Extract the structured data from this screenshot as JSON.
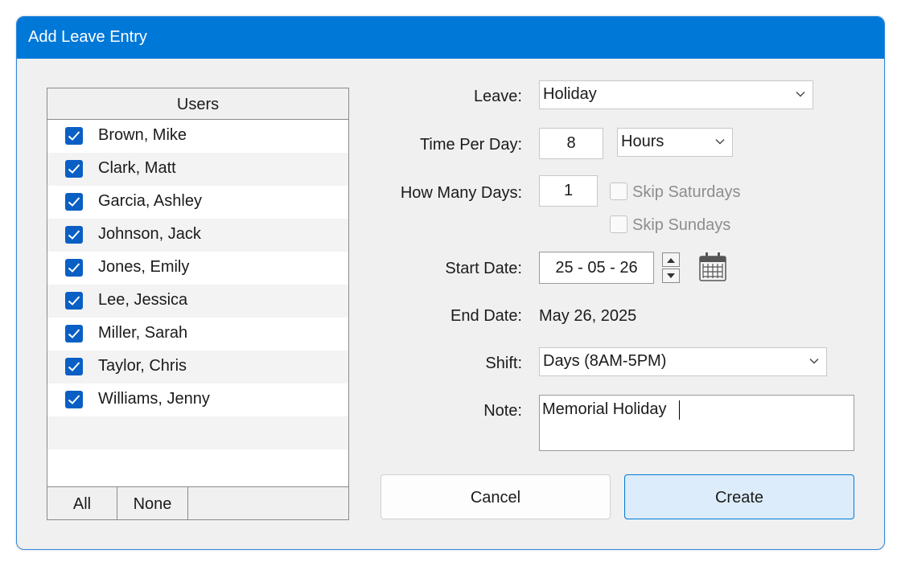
{
  "window": {
    "title": "Add Leave Entry"
  },
  "users": {
    "header": "Users",
    "items": [
      {
        "name": "Brown, Mike",
        "checked": true
      },
      {
        "name": "Clark, Matt",
        "checked": true
      },
      {
        "name": "Garcia, Ashley",
        "checked": true
      },
      {
        "name": "Johnson, Jack",
        "checked": true
      },
      {
        "name": "Jones, Emily",
        "checked": true
      },
      {
        "name": "Lee, Jessica",
        "checked": true
      },
      {
        "name": "Miller, Sarah",
        "checked": true
      },
      {
        "name": "Taylor, Chris",
        "checked": true
      },
      {
        "name": "Williams, Jenny",
        "checked": true
      }
    ],
    "all_label": "All",
    "none_label": "None"
  },
  "form": {
    "leave_label": "Leave:",
    "leave_value": "Holiday",
    "time_per_day_label": "Time Per Day:",
    "time_per_day_value": "8",
    "time_unit_value": "Hours",
    "how_many_days_label": "How Many Days:",
    "how_many_days_value": "1",
    "skip_saturdays_label": "Skip Saturdays",
    "skip_saturdays_checked": false,
    "skip_sundays_label": "Skip Sundays",
    "skip_sundays_checked": false,
    "start_date_label": "Start Date:",
    "start_date_value": "25 - 05 - 26",
    "end_date_label": "End Date:",
    "end_date_value": "May 26, 2025",
    "shift_label": "Shift:",
    "shift_value": "Days (8AM-5PM)",
    "note_label": "Note:",
    "note_value": "Memorial Holiday"
  },
  "buttons": {
    "cancel": "Cancel",
    "create": "Create"
  },
  "colors": {
    "titlebar": "#0078d7",
    "checkbox": "#0a5fc4",
    "primary_button_bg": "#dcecfa",
    "primary_button_border": "#0078d7"
  }
}
